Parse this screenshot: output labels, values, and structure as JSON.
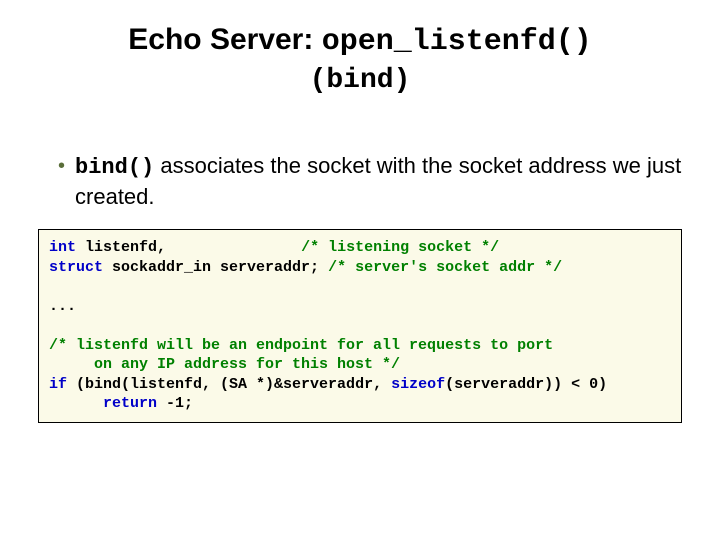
{
  "title_prefix": "Echo Server: ",
  "title_mono": "open_listenfd()",
  "subtitle": "(bind)",
  "bullet": {
    "mono": "bind()",
    "rest": " associates the socket with the socket address we just created."
  },
  "code": {
    "l1_a": "int",
    "l1_b": " listenfd,               ",
    "l1_c": "/* listening socket */",
    "l2_a": "struct",
    "l2_b": " sockaddr_in serveraddr; ",
    "l2_c": "/* server's socket addr */",
    "blank1": "",
    "l3": "...",
    "blank2": "",
    "l4": "/* listenfd will be an endpoint for all requests to port",
    "l5": "     on any IP address for this host */",
    "l6_a": "if",
    "l6_b": " (bind(listenfd, (SA *)&serveraddr, ",
    "l6_c": "sizeof",
    "l6_d": "(serveraddr)) < 0)",
    "l7_a": "      ",
    "l7_b": "return",
    "l7_c": " -1;"
  }
}
